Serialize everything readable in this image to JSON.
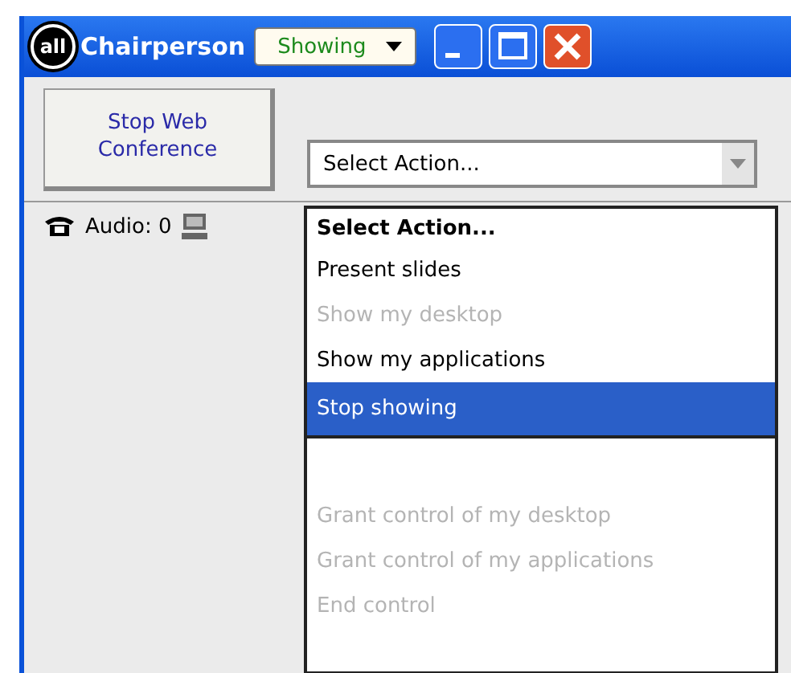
{
  "window": {
    "logo": "all",
    "title": "Chairperson",
    "status_menu": {
      "value": "Showing"
    }
  },
  "stop_button": {
    "label": "Stop Web Conference"
  },
  "status": {
    "audio": "Audio: 0"
  },
  "action_select": {
    "value": "Select Action...",
    "open": true
  },
  "action_menu": [
    {
      "kind": "header",
      "label": "Select Action...",
      "disabled": false,
      "selected": false
    },
    {
      "kind": "item",
      "label": "Present slides",
      "disabled": false,
      "selected": false
    },
    {
      "kind": "item",
      "label": "Show my desktop",
      "disabled": true,
      "selected": false
    },
    {
      "kind": "item",
      "label": "Show my applications",
      "disabled": false,
      "selected": false
    },
    {
      "kind": "item",
      "label": "Stop showing",
      "disabled": false,
      "selected": true
    },
    {
      "kind": "separator"
    },
    {
      "kind": "item",
      "label": "Grant control of my desktop",
      "disabled": true,
      "selected": false
    },
    {
      "kind": "item",
      "label": "Grant control of my applications",
      "disabled": true,
      "selected": false
    },
    {
      "kind": "item",
      "label": "End control",
      "disabled": true,
      "selected": false
    }
  ]
}
